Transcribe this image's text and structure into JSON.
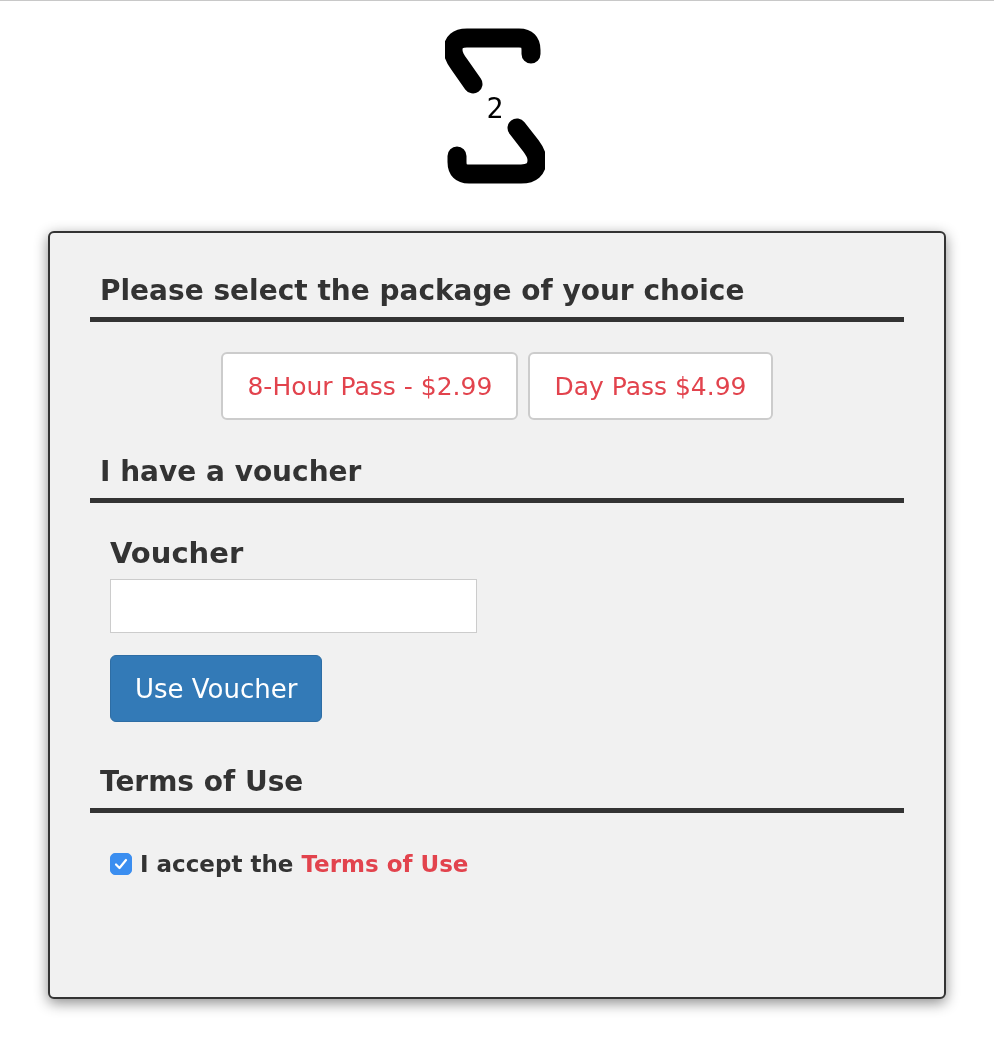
{
  "logo": {
    "text": "2"
  },
  "sections": [
    {
      "title": "Please select the package of your choice"
    },
    {
      "title": "I have a voucher"
    },
    {
      "title": "Terms of Use"
    }
  ],
  "packages": [
    {
      "label": "8-Hour Pass - $2.99"
    },
    {
      "label": "Day Pass $4.99"
    }
  ],
  "voucher": {
    "label": "Voucher",
    "button": "Use Voucher"
  },
  "terms": {
    "checked": true,
    "text": "I accept the",
    "link": "Terms of Use"
  }
}
